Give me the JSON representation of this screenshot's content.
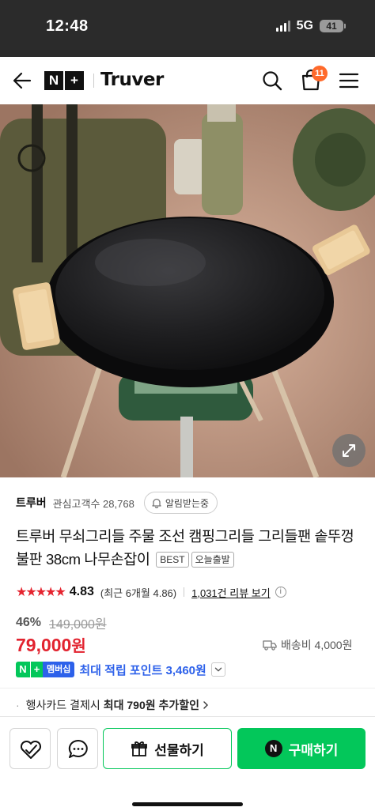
{
  "status_bar": {
    "time": "12:48",
    "network": "5G",
    "battery": "41"
  },
  "nav": {
    "brand_nplus": [
      "N",
      "+"
    ],
    "brand": "Truver",
    "cart_count": "11"
  },
  "hero": {
    "alt": "product photo: round cast-iron griddle pan with wooden handles on camping stove"
  },
  "seller": {
    "name": "트루버",
    "fans_label": "관심고객수 28,768",
    "alarm_label": "알림받는중"
  },
  "product": {
    "title": "트루버 무쇠그리들 주물 조선 캠핑그리들 그리들팬 솥뚜껑 불판 38cm 나무손잡이",
    "tags": [
      "BEST",
      "오늘출발"
    ]
  },
  "rating": {
    "stars": "★★★★★",
    "score": "4.83",
    "recent": "(최근 6개월 4.86)",
    "review_link": "1,031건 리뷰 보기",
    "info": "i",
    "value": 4.83
  },
  "price": {
    "discount": "46%",
    "original": "149,000원",
    "current": "79,000",
    "currency": "원",
    "shipping": "배송비 4,000원"
  },
  "points": {
    "badge_n": "N",
    "badge_plus": "+",
    "badge_member": "멤버십",
    "text": "최대 적립 포인트 3,460원"
  },
  "card_benefit": {
    "prefix": "행사카드 결제시",
    "highlight": "최대 790원 추가할인"
  },
  "bottom": {
    "gift_label": "선물하기",
    "buy_label": "구매하기",
    "buy_badge": "N"
  },
  "colors": {
    "accent_green": "#03c75a",
    "price_red": "#e2232f",
    "point_blue": "#2d61ea",
    "cart_badge": "#ff6a2b"
  }
}
